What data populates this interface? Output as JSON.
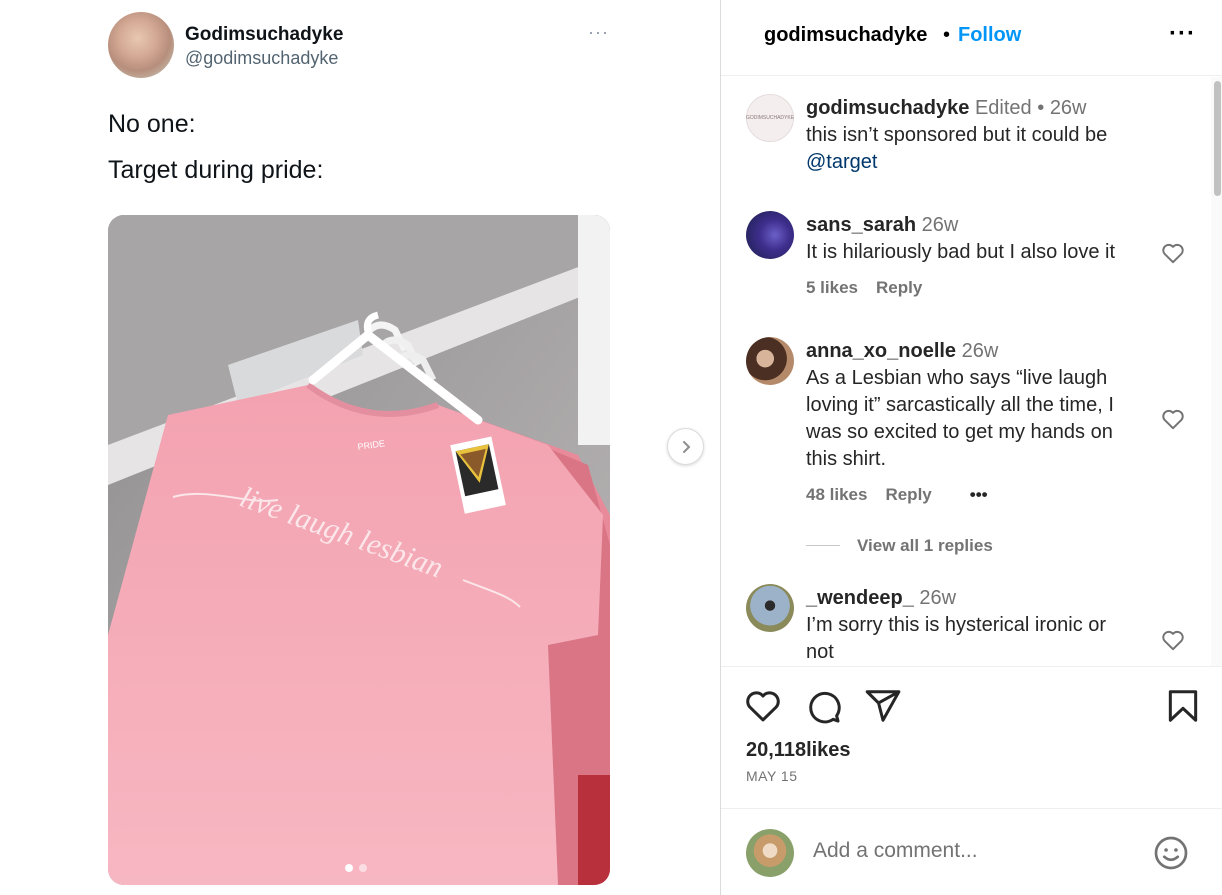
{
  "tweet": {
    "display_name": "Godimsuchadyke",
    "handle": "@godimsuchadyke",
    "more": "···",
    "lines": [
      "No one:",
      "Target during pride:"
    ],
    "shirt_text": "live laugh lesbian",
    "tag_text": "PRIDE"
  },
  "carousel": {
    "slide_count": 2,
    "active_slide": 1
  },
  "post_header": {
    "username": "godimsuchadyke",
    "separator": "•",
    "follow_label": "Follow",
    "more": "···"
  },
  "caption": {
    "avatar_text": "GODIMSUCHADYKE",
    "username": "godimsuchadyke",
    "edited": "Edited",
    "separator": "•",
    "time": "26w",
    "text": "this isn’t sponsored but it could be",
    "mention": "@target"
  },
  "comments": [
    {
      "username": "sans_sarah",
      "time": "26w",
      "text": "It is hilariously bad but I also love it",
      "likes": "5 likes",
      "reply": "Reply"
    },
    {
      "username": "anna_xo_noelle",
      "time": "26w",
      "text_lines": [
        "As a Lesbian who says “live laugh",
        "loving it” sarcastically all the time, I",
        "was so excited to get my hands on",
        "this shirt."
      ],
      "likes": "48 likes",
      "reply": "Reply",
      "more": "•••",
      "view_replies": "View all 1 replies"
    },
    {
      "username": "_wendeep_",
      "time": "26w",
      "text_lines": [
        "I’m sorry this is hysterical ironic or",
        "not"
      ]
    }
  ],
  "actions": {
    "likes": "20,118likes",
    "date": "MAY 15"
  },
  "add_comment": {
    "placeholder": "Add a comment..."
  },
  "colors": {
    "accent": "#0095f6",
    "mention": "#00376b",
    "secondary": "#737373",
    "shirt": "#f2a3b0"
  },
  "icons": [
    "more-icon",
    "chevron-right-icon",
    "heart-icon",
    "comment-icon",
    "share-icon",
    "bookmark-icon",
    "emoji-icon"
  ]
}
